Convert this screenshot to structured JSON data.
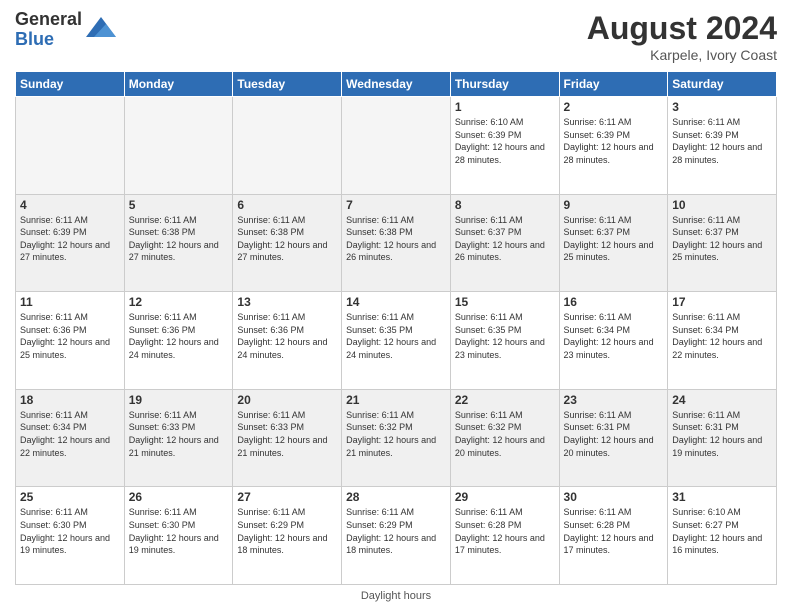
{
  "logo": {
    "general": "General",
    "blue": "Blue"
  },
  "title": {
    "month_year": "August 2024",
    "location": "Karpele, Ivory Coast"
  },
  "footer": {
    "daylight_label": "Daylight hours"
  },
  "days_of_week": [
    "Sunday",
    "Monday",
    "Tuesday",
    "Wednesday",
    "Thursday",
    "Friday",
    "Saturday"
  ],
  "weeks": [
    {
      "days": [
        {
          "num": "",
          "empty": true
        },
        {
          "num": "",
          "empty": true
        },
        {
          "num": "",
          "empty": true
        },
        {
          "num": "",
          "empty": true
        },
        {
          "num": "1",
          "sunrise": "6:10 AM",
          "sunset": "6:39 PM",
          "daylight": "12 hours and 28 minutes."
        },
        {
          "num": "2",
          "sunrise": "6:11 AM",
          "sunset": "6:39 PM",
          "daylight": "12 hours and 28 minutes."
        },
        {
          "num": "3",
          "sunrise": "6:11 AM",
          "sunset": "6:39 PM",
          "daylight": "12 hours and 28 minutes."
        }
      ]
    },
    {
      "shaded": true,
      "days": [
        {
          "num": "4",
          "sunrise": "6:11 AM",
          "sunset": "6:39 PM",
          "daylight": "12 hours and 27 minutes."
        },
        {
          "num": "5",
          "sunrise": "6:11 AM",
          "sunset": "6:38 PM",
          "daylight": "12 hours and 27 minutes."
        },
        {
          "num": "6",
          "sunrise": "6:11 AM",
          "sunset": "6:38 PM",
          "daylight": "12 hours and 27 minutes."
        },
        {
          "num": "7",
          "sunrise": "6:11 AM",
          "sunset": "6:38 PM",
          "daylight": "12 hours and 26 minutes."
        },
        {
          "num": "8",
          "sunrise": "6:11 AM",
          "sunset": "6:37 PM",
          "daylight": "12 hours and 26 minutes."
        },
        {
          "num": "9",
          "sunrise": "6:11 AM",
          "sunset": "6:37 PM",
          "daylight": "12 hours and 25 minutes."
        },
        {
          "num": "10",
          "sunrise": "6:11 AM",
          "sunset": "6:37 PM",
          "daylight": "12 hours and 25 minutes."
        }
      ]
    },
    {
      "days": [
        {
          "num": "11",
          "sunrise": "6:11 AM",
          "sunset": "6:36 PM",
          "daylight": "12 hours and 25 minutes."
        },
        {
          "num": "12",
          "sunrise": "6:11 AM",
          "sunset": "6:36 PM",
          "daylight": "12 hours and 24 minutes."
        },
        {
          "num": "13",
          "sunrise": "6:11 AM",
          "sunset": "6:36 PM",
          "daylight": "12 hours and 24 minutes."
        },
        {
          "num": "14",
          "sunrise": "6:11 AM",
          "sunset": "6:35 PM",
          "daylight": "12 hours and 24 minutes."
        },
        {
          "num": "15",
          "sunrise": "6:11 AM",
          "sunset": "6:35 PM",
          "daylight": "12 hours and 23 minutes."
        },
        {
          "num": "16",
          "sunrise": "6:11 AM",
          "sunset": "6:34 PM",
          "daylight": "12 hours and 23 minutes."
        },
        {
          "num": "17",
          "sunrise": "6:11 AM",
          "sunset": "6:34 PM",
          "daylight": "12 hours and 22 minutes."
        }
      ]
    },
    {
      "shaded": true,
      "days": [
        {
          "num": "18",
          "sunrise": "6:11 AM",
          "sunset": "6:34 PM",
          "daylight": "12 hours and 22 minutes."
        },
        {
          "num": "19",
          "sunrise": "6:11 AM",
          "sunset": "6:33 PM",
          "daylight": "12 hours and 21 minutes."
        },
        {
          "num": "20",
          "sunrise": "6:11 AM",
          "sunset": "6:33 PM",
          "daylight": "12 hours and 21 minutes."
        },
        {
          "num": "21",
          "sunrise": "6:11 AM",
          "sunset": "6:32 PM",
          "daylight": "12 hours and 21 minutes."
        },
        {
          "num": "22",
          "sunrise": "6:11 AM",
          "sunset": "6:32 PM",
          "daylight": "12 hours and 20 minutes."
        },
        {
          "num": "23",
          "sunrise": "6:11 AM",
          "sunset": "6:31 PM",
          "daylight": "12 hours and 20 minutes."
        },
        {
          "num": "24",
          "sunrise": "6:11 AM",
          "sunset": "6:31 PM",
          "daylight": "12 hours and 19 minutes."
        }
      ]
    },
    {
      "days": [
        {
          "num": "25",
          "sunrise": "6:11 AM",
          "sunset": "6:30 PM",
          "daylight": "12 hours and 19 minutes."
        },
        {
          "num": "26",
          "sunrise": "6:11 AM",
          "sunset": "6:30 PM",
          "daylight": "12 hours and 19 minutes."
        },
        {
          "num": "27",
          "sunrise": "6:11 AM",
          "sunset": "6:29 PM",
          "daylight": "12 hours and 18 minutes."
        },
        {
          "num": "28",
          "sunrise": "6:11 AM",
          "sunset": "6:29 PM",
          "daylight": "12 hours and 18 minutes."
        },
        {
          "num": "29",
          "sunrise": "6:11 AM",
          "sunset": "6:28 PM",
          "daylight": "12 hours and 17 minutes."
        },
        {
          "num": "30",
          "sunrise": "6:11 AM",
          "sunset": "6:28 PM",
          "daylight": "12 hours and 17 minutes."
        },
        {
          "num": "31",
          "sunrise": "6:10 AM",
          "sunset": "6:27 PM",
          "daylight": "12 hours and 16 minutes."
        }
      ]
    }
  ]
}
